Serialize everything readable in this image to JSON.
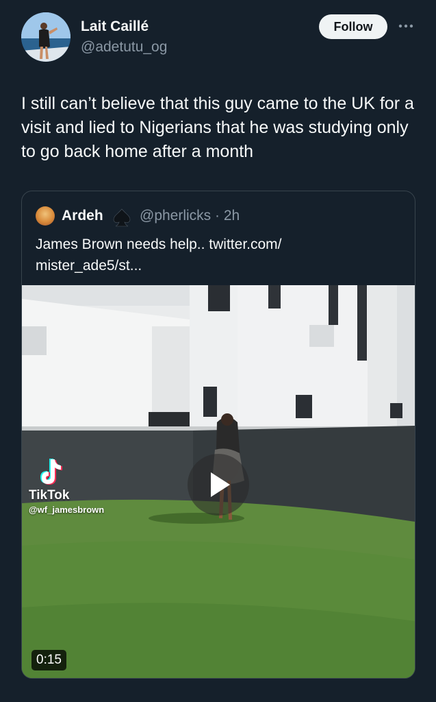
{
  "tweet": {
    "display_name": "Lait Caillé",
    "handle": "@adetutu_og",
    "follow_label": "Follow",
    "more_icon": "more-horizontal-icon",
    "text": "I still can’t believe that this guy came to the UK for a visit and lied to Nigerians that he was studying only to go back home after a month"
  },
  "quote": {
    "display_name": "Ardeh",
    "badge_icon": "spade-icon",
    "handle_time": "@pherlicks · 2h",
    "text_line1": "James Brown needs help.. twitter.com/",
    "text_line2": "mister_ade5/st...",
    "video": {
      "watermark_label": "TikTok",
      "watermark_handle": "@wf_jamesbrown",
      "duration": "0:15",
      "play_icon": "play-icon"
    }
  },
  "colors": {
    "background": "#15202b",
    "text_primary": "#f7f9f9",
    "text_secondary": "#8b98a5",
    "border": "#38444d",
    "follow_bg": "#eff3f4"
  }
}
